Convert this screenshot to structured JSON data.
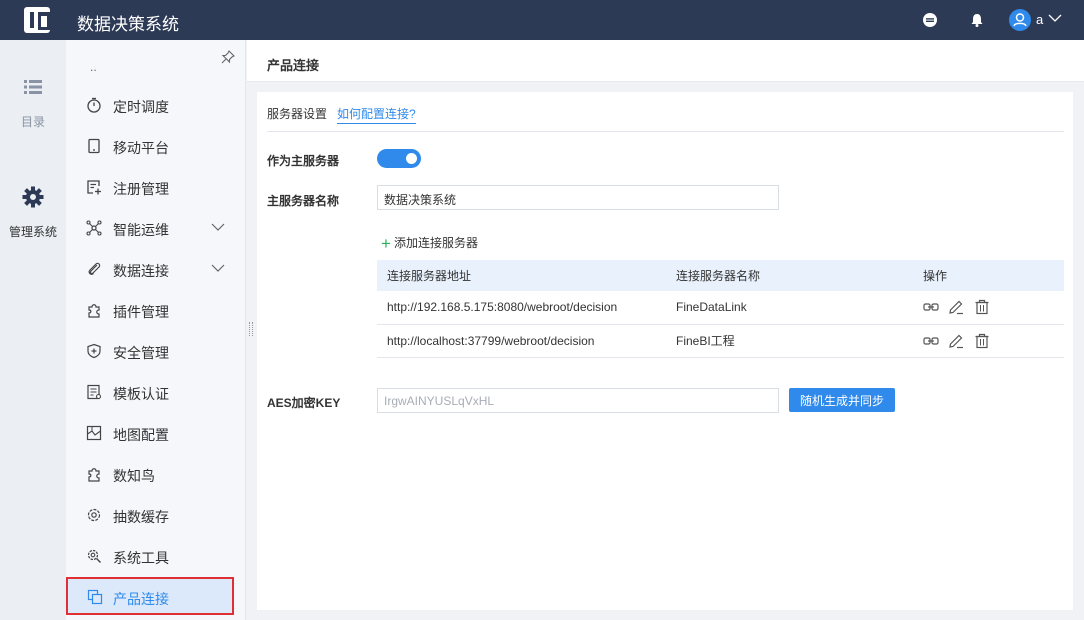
{
  "app": {
    "title": "数据决策系统",
    "user_name": "a"
  },
  "rail": [
    {
      "label": "目录",
      "icon": "list-icon"
    },
    {
      "label": "管理系统",
      "icon": "gear-icon"
    }
  ],
  "sidebar": {
    "overflow_text": "..",
    "items": [
      {
        "label": "定时调度",
        "icon": "stopwatch-icon"
      },
      {
        "label": "移动平台",
        "icon": "tablet-icon"
      },
      {
        "label": "注册管理",
        "icon": "register-icon"
      },
      {
        "label": "智能运维",
        "icon": "network-icon",
        "expandable": true
      },
      {
        "label": "数据连接",
        "icon": "paperclip-icon",
        "expandable": true
      },
      {
        "label": "插件管理",
        "icon": "puzzle-icon"
      },
      {
        "label": "安全管理",
        "icon": "shield-icon"
      },
      {
        "label": "模板认证",
        "icon": "template-icon"
      },
      {
        "label": "地图配置",
        "icon": "map-icon"
      },
      {
        "label": "数知鸟",
        "icon": "puzzle-icon"
      },
      {
        "label": "抽数缓存",
        "icon": "gear-outline-icon"
      },
      {
        "label": "系统工具",
        "icon": "tools-icon"
      },
      {
        "label": "产品连接",
        "icon": "copy-icon",
        "active": true
      }
    ]
  },
  "page": {
    "title": "产品连接",
    "server_settings_label": "服务器设置",
    "help_link": "如何配置连接?",
    "as_main_server_label": "作为主服务器",
    "as_main_server_on": true,
    "main_server_name_label": "主服务器名称",
    "main_server_name_value": "数据决策系统",
    "add_server_label": "添加连接服务器",
    "table": {
      "headers": [
        "连接服务器地址",
        "连接服务器名称",
        "操作"
      ],
      "rows": [
        {
          "address": "http://192.168.5.175:8080/webroot/decision",
          "name": "FineDataLink"
        },
        {
          "address": "http://localhost:37799/webroot/decision",
          "name": "FineBI工程"
        }
      ]
    },
    "aes_label": "AES加密KEY",
    "aes_value": "IrgwAINYUSLqVxHL",
    "generate_button": "随机生成并同步"
  },
  "colors": {
    "topbar": "#2c3a55",
    "accent": "#2f8aeb",
    "active_bg": "#dbe9fb",
    "highlight_border": "#e02f35"
  }
}
